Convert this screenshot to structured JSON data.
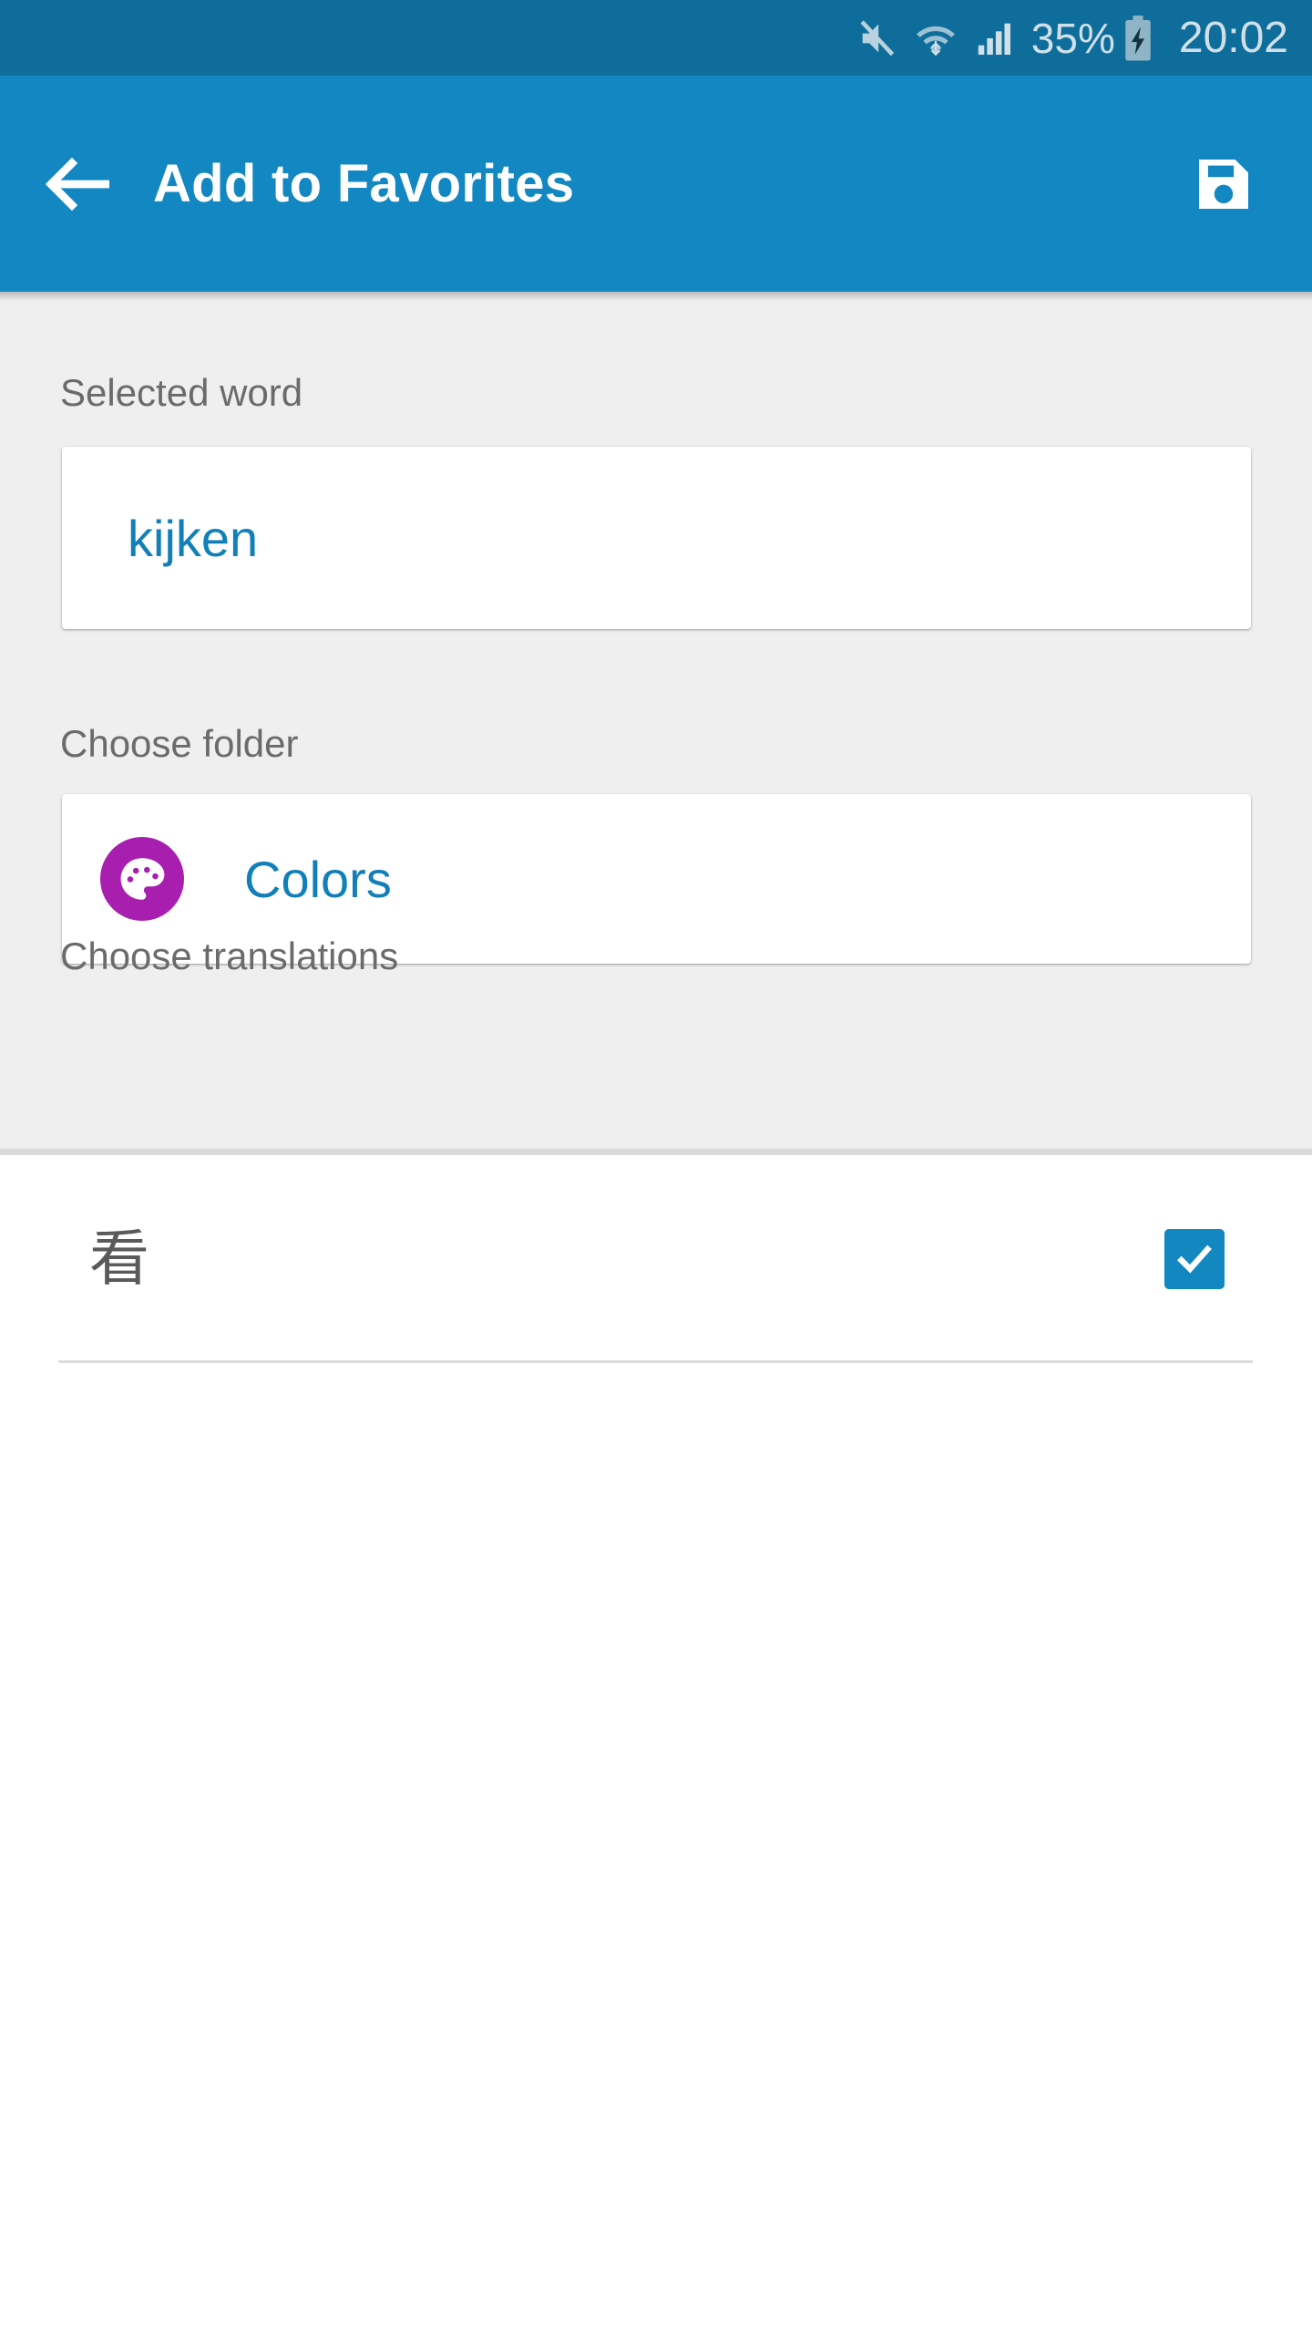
{
  "status_bar": {
    "battery_percent": "35%",
    "time": "20:02",
    "icons": [
      "mute-icon",
      "wifi-icon",
      "signal-icon",
      "battery-charging-icon"
    ],
    "background_color": "#0f6d9b",
    "text_color": "#cfe0e9"
  },
  "toolbar": {
    "title": "Add to Favorites",
    "back_icon": "arrow-back-icon",
    "save_icon": "save-floppy-icon",
    "background_color": "#1387c2",
    "text_color": "#ffffff"
  },
  "form": {
    "background_color": "#efefef",
    "selected_word": {
      "label": "Selected word",
      "value": "kijken",
      "value_color": "#1180b8"
    },
    "folder": {
      "label": "Choose folder",
      "name": "Colors",
      "icon": "palette-icon",
      "icon_background_color": "#a81fb0",
      "name_color": "#1180b8"
    },
    "translations": {
      "label": "Choose translations",
      "items": [
        {
          "text": "看",
          "checked": true
        }
      ],
      "checkbox_color": "#1287c0"
    }
  }
}
